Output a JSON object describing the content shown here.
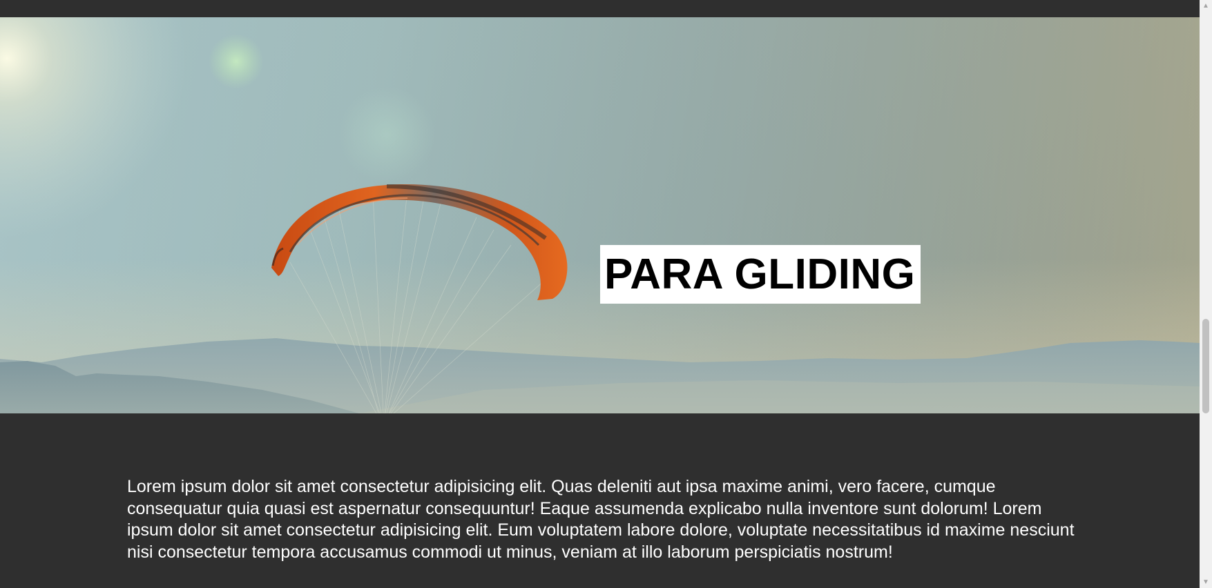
{
  "hero": {
    "title": "PARA GLIDING",
    "image_alt": "paraglider wing in sky over mountains"
  },
  "content": {
    "paragraph": "Lorem ipsum dolor sit amet consectetur adipisicing elit. Quas deleniti aut ipsa maxime animi, vero facere, cumque consequatur quia quasi est aspernatur consequuntur! Eaque assumenda explicabo nulla inventore sunt dolorum! Lorem ipsum dolor sit amet consectetur adipisicing elit. Eum voluptatem labore dolore, voluptate necessitatibus id maxime nesciunt nisi consectetur tempora accusamus commodi ut minus, veniam at illo laborum perspiciatis nostrum!"
  },
  "scrollbar": {
    "up_icon": "chevron-up-icon",
    "down_icon": "chevron-down-icon"
  },
  "colors": {
    "page_background": "#2f2f2f",
    "title_background": "#ffffff",
    "title_text": "#000000",
    "body_text": "#ffffff",
    "wing_orange": "#d9541a"
  }
}
